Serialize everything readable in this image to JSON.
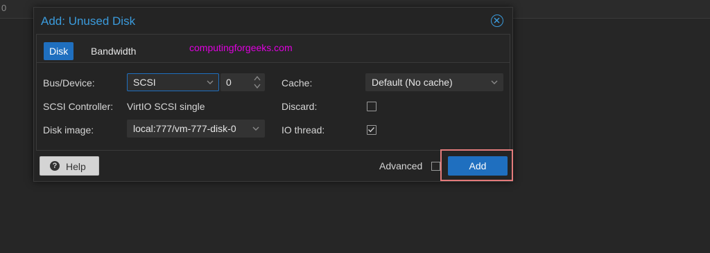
{
  "background": {
    "fragment": "0"
  },
  "dialog": {
    "title": "Add: Unused Disk",
    "tabs": [
      {
        "label": "Disk",
        "active": true
      },
      {
        "label": "Bandwidth",
        "active": false
      }
    ],
    "watermark": "computingforgeeks.com"
  },
  "form": {
    "bus_device_label": "Bus/Device:",
    "bus_value": "SCSI",
    "device_number": "0",
    "scsi_controller_label": "SCSI Controller:",
    "scsi_controller_value": "VirtIO SCSI single",
    "disk_image_label": "Disk image:",
    "disk_image_value": "local:777/vm-777-disk-0",
    "cache_label": "Cache:",
    "cache_value": "Default (No cache)",
    "discard_label": "Discard:",
    "discard_checked": false,
    "io_thread_label": "IO thread:",
    "io_thread_checked": true
  },
  "footer": {
    "help_label": "Help",
    "advanced_label": "Advanced",
    "advanced_checked": false,
    "add_label": "Add"
  },
  "colors": {
    "accent": "#1f6fbf",
    "title": "#3b9bdc",
    "highlight": "#e37b7b",
    "watermark": "#e000e0"
  },
  "icons": [
    "close-icon",
    "chevron-down-icon",
    "spinner-arrows-icon",
    "help-icon",
    "checkmark-icon"
  ]
}
